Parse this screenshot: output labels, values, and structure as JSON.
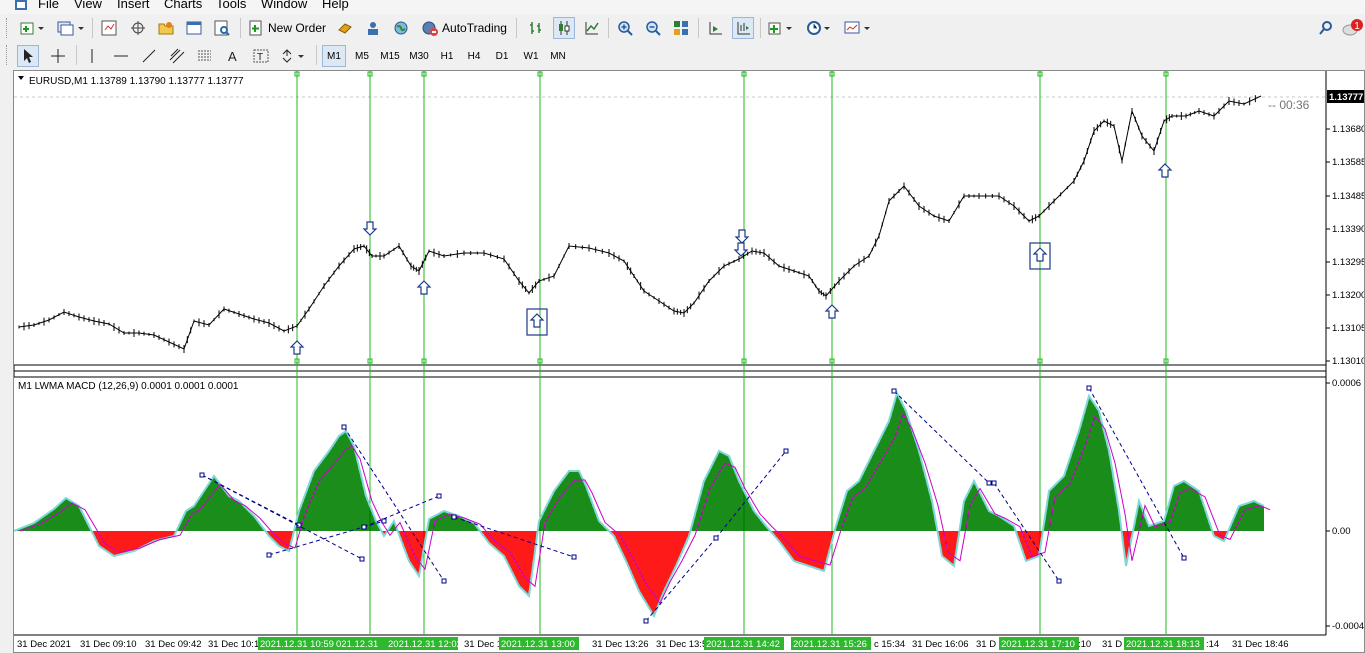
{
  "menu": {
    "items": [
      "File",
      "View",
      "Insert",
      "Charts",
      "Tools",
      "Window",
      "Help"
    ]
  },
  "toolbar": {
    "new_order": "New Order",
    "autotrading": "AutoTrading"
  },
  "timeframes": [
    "M1",
    "M5",
    "M15",
    "M30",
    "H1",
    "H4",
    "D1",
    "W1",
    "MN"
  ],
  "active_timeframe": "M1",
  "chart": {
    "header": "EURUSD,M1  1.13789 1.13790 1.13777 1.13777",
    "countdown": "-- 00:36",
    "bid_label": "1.13777",
    "price_ticks": [
      "1.13680",
      "1.13585",
      "1.13485",
      "1.13390",
      "1.13295",
      "1.13200",
      "1.13105",
      "1.13010"
    ],
    "macd_header": "M1 LWMA MACD (12,26,9) 0.0001 0.0001 0.0001",
    "macd_ticks": [
      "0.0006",
      "0.00",
      "-0.0004"
    ],
    "time_labels": [
      "31 Dec 2021",
      "31 Dec 09:10",
      "31 Dec 09:42",
      "31 Dec 10:1",
      "2021.12.31 10:59",
      "021.12.31",
      "2021.12.31 12:02",
      "31 Dec 1",
      "2021.12.31 13:00",
      "31 Dec 13:26",
      "31 Dec 13:5",
      "2021.12.31 14:42",
      "2021.12.31 15:26",
      "c 15:34",
      "31 Dec 16:06",
      "31 D",
      "2021.12.31 17:10",
      ":10",
      "31 D",
      "2021.12.31 18:13",
      ":14",
      "31 Dec 18:46"
    ],
    "colors": {
      "up": "#008000",
      "down": "#ff0000",
      "signal": "#cc00cc",
      "vline": "#22bb22",
      "label_bg": "#2db82d",
      "arrow": "#1a3a8a",
      "trend": "#00008b"
    }
  }
}
